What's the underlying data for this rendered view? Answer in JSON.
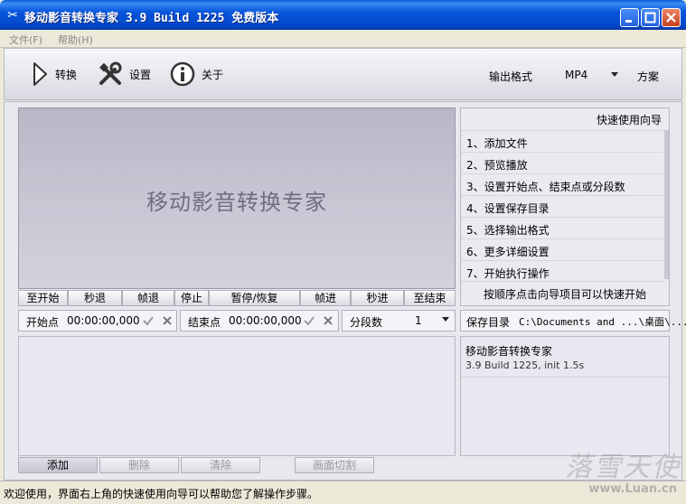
{
  "window": {
    "title": "移动影音转换专家 3.9 Build 1225 免费版本"
  },
  "menu": {
    "file": "文件(F)",
    "help": "帮助(H)"
  },
  "toolbar": {
    "convert": "转换",
    "settings": "设置",
    "about": "关于",
    "output_format_label": "输出格式",
    "output_format_value": "MP4",
    "scheme": "方案"
  },
  "preview": {
    "watermark_text": "移动影音转换专家"
  },
  "controls": [
    "至开始",
    "秒退",
    "帧退",
    "停止",
    "暂停/恢复",
    "帧进",
    "秒进",
    "至结束"
  ],
  "start_point": {
    "label": "开始点",
    "time": "00:00:00,000"
  },
  "end_point": {
    "label": "结束点",
    "time": "00:00:00,000"
  },
  "segments": {
    "label": "分段数",
    "value": "1"
  },
  "list_buttons": {
    "add": "添加",
    "delete": "删除",
    "clear": "清除",
    "crop": "画面切割"
  },
  "guide": {
    "title": "快速使用向导",
    "items": [
      "1、添加文件",
      "2、预览播放",
      "3、设置开始点、结束点或分段数",
      "4、设置保存目录",
      "5、选择输出格式",
      "6、更多详细设置",
      "7、开始执行操作"
    ],
    "footer": "按顺序点击向导项目可以快速开始"
  },
  "save": {
    "label": "保存目录",
    "path": "C:\\Documents and ...\\桌面\\..."
  },
  "info": {
    "app_name": "移动影音转换专家",
    "version": "3.9 Build 1225, init 1.5s"
  },
  "status": {
    "text": "欢迎使用，界面右上角的快速使用向导可以帮助您了解操作步骤。"
  },
  "watermark": {
    "text": "落雪天使",
    "url": "www.Luan.cn"
  }
}
